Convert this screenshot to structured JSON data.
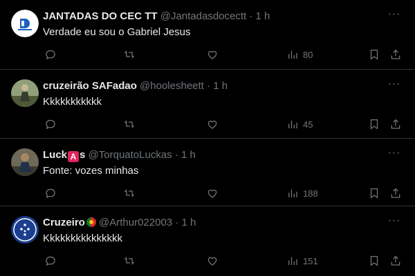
{
  "tweets": [
    {
      "name": "JANTADAS DO CEC TT",
      "handle": "@Jantadasdocectt",
      "time": "1 h",
      "text": "Verdade eu sou o Gabriel Jesus",
      "views": "80"
    },
    {
      "name": "cruzeirão SAFadao",
      "handle": "@hoolesheett",
      "time": "1 h",
      "text": "Kkkkkkkkkkk",
      "views": "45"
    },
    {
      "name_prefix": "Luck",
      "name_badge": "A",
      "name_suffix": "s",
      "handle": "@TorquatoLuckas",
      "time": "1 h",
      "text": "Fonte: vozes minhas",
      "views": "188"
    },
    {
      "name": "Cruzeiro",
      "handle": "@Arthur022003",
      "time": "1 h",
      "text": "Kkkkkkkkkkkkkkk",
      "views": "151"
    }
  ],
  "separator": "·",
  "more_glyph": "···",
  "icons": {
    "reply": "reply-icon",
    "retweet": "retweet-icon",
    "like": "heart-icon",
    "views": "analytics-icon",
    "bookmark": "bookmark-icon",
    "share": "share-icon",
    "more": "more-icon"
  },
  "colors": {
    "background": "#000000",
    "primary_text": "#e7e9ea",
    "secondary_text": "#71767b",
    "divider": "#2f3336"
  }
}
